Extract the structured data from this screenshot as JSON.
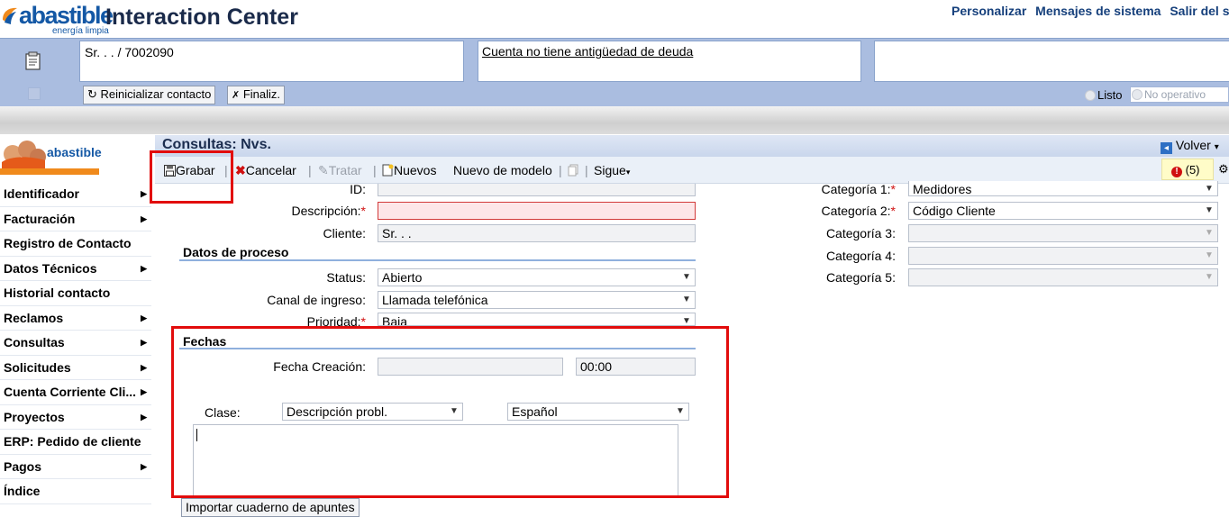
{
  "header": {
    "logo_text": "abastible",
    "logo_subtext": "energía limpia",
    "title": "Interaction Center",
    "links": [
      "Personalizar",
      "Mensajes de sistema",
      "Salir del sis"
    ]
  },
  "contact": {
    "name": "Sr. . . / 7002090",
    "debt_status": "Cuenta no tiene antigüedad de deuda",
    "reset_label": "Reinicializar contacto",
    "finish_label": "Finaliz.",
    "status_ready": "Listo",
    "status_not_operational": "No operativo"
  },
  "left_logo": {
    "text": "abastible"
  },
  "nav": {
    "items": [
      {
        "label": "Identificador",
        "arrow": "▶"
      },
      {
        "label": "Facturación",
        "arrow": "▶"
      },
      {
        "label": "Registro de Contacto",
        "arrow": ""
      },
      {
        "label": "Datos Técnicos",
        "arrow": "▶"
      },
      {
        "label": "Historial contacto",
        "arrow": ""
      },
      {
        "label": "Reclamos",
        "arrow": "▶"
      },
      {
        "label": "Consultas",
        "arrow": "▶"
      },
      {
        "label": "Solicitudes",
        "arrow": "▶"
      },
      {
        "label": "Cuenta Corriente Cli...",
        "arrow": "▶"
      },
      {
        "label": "Proyectos",
        "arrow": "▶"
      },
      {
        "label": "ERP: Pedido de cliente",
        "arrow": ""
      },
      {
        "label": "Pagos",
        "arrow": "▶"
      },
      {
        "label": "Índice",
        "arrow": ""
      }
    ]
  },
  "content": {
    "title": "Consultas: Nvs.",
    "back_label": "Volver",
    "back_arrow": "▾",
    "toolbar": {
      "save": "Grabar",
      "cancel": "Cancelar",
      "process": "Tratar",
      "new": "Nuevos",
      "new_from_template": "Nuevo de modelo",
      "next": "Sigue",
      "next_arrow": "▾"
    },
    "messages_count": "(5)"
  },
  "form": {
    "id_label": "ID:",
    "description_label": "Descripción:",
    "customer_label": "Cliente:",
    "customer_value": "Sr. . .",
    "process_section": "Datos de proceso",
    "status_label": "Status:",
    "status_value": "Abierto",
    "channel_label": "Canal de ingreso:",
    "channel_value": "Llamada telefónica",
    "priority_label": "Prioridad:",
    "priority_value": "Baja",
    "dates_section": "Fechas",
    "creation_date_label": "Fecha Creación:",
    "creation_time_value": "00:00",
    "class_label": "Clase:",
    "class_value": "Descripción probl.",
    "language_value": "Español",
    "import_label": "Importar cuaderno de apuntes",
    "categories": [
      {
        "label": "Categoría 1:",
        "value": "Medidores",
        "required": true
      },
      {
        "label": "Categoría 2:",
        "value": "Código Cliente",
        "required": true
      },
      {
        "label": "Categoría 3:",
        "value": "",
        "required": false
      },
      {
        "label": "Categoría 4:",
        "value": "",
        "required": false
      },
      {
        "label": "Categoría 5:",
        "value": "",
        "required": false
      }
    ]
  },
  "icons": {
    "dropdown": "▼",
    "required_mark": "*"
  },
  "colors": {
    "brand_blue": "#1458a5",
    "header_band": "#aabde0",
    "highlight_red": "#e20c0c",
    "required_red": "#d01010"
  }
}
